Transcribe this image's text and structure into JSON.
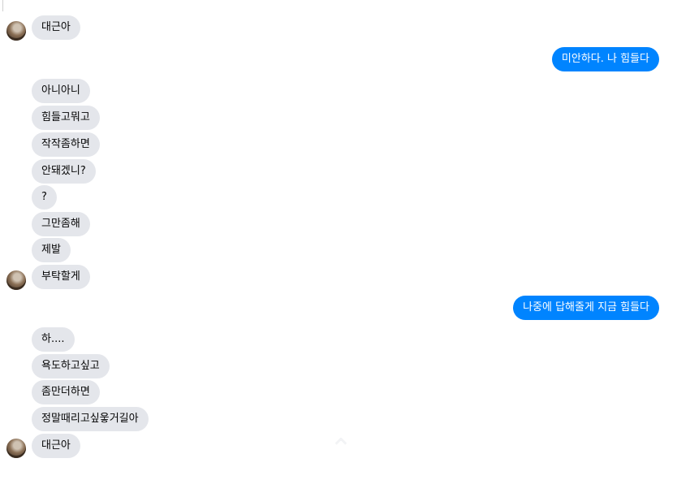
{
  "conversation": {
    "messages": [
      {
        "side": "in",
        "text": "대근아"
      },
      {
        "side": "out",
        "text": "미안하다. 나 힘들다"
      },
      {
        "side": "in",
        "text": "아니아니"
      },
      {
        "side": "in",
        "text": "힘들고뭐고"
      },
      {
        "side": "in",
        "text": "작작좀하면"
      },
      {
        "side": "in",
        "text": "안돼겠니?"
      },
      {
        "side": "in",
        "text": "?"
      },
      {
        "side": "in",
        "text": "그만좀해"
      },
      {
        "side": "in",
        "text": "제발"
      },
      {
        "side": "in",
        "text": "부탁할게"
      },
      {
        "side": "out",
        "text": "나중에 답해줄게 지금 힘들다"
      },
      {
        "side": "in",
        "text": "하...."
      },
      {
        "side": "in",
        "text": "욕도하고싶고"
      },
      {
        "side": "in",
        "text": "좀만더하면"
      },
      {
        "side": "in",
        "text": "정말때리고싶웋거길아"
      },
      {
        "side": "in",
        "text": "대근아"
      }
    ]
  },
  "colors": {
    "incoming_bubble": "#e4e6eb",
    "outgoing_bubble": "#0084ff",
    "outgoing_text": "#ffffff"
  },
  "icons": {
    "avatar": "contact-avatar",
    "scroll": "chevron-up-icon"
  }
}
